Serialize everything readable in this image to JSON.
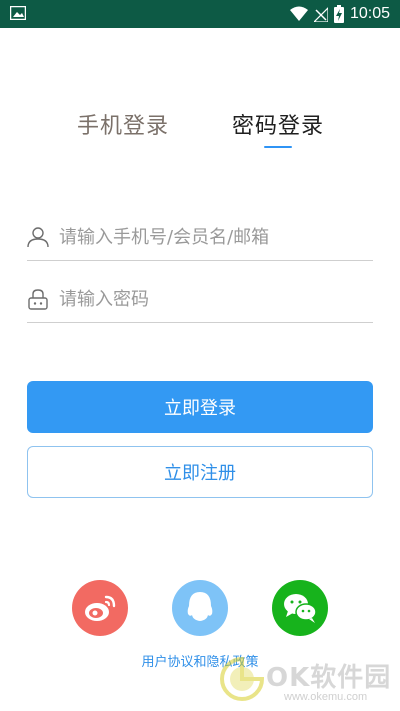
{
  "status_bar": {
    "time": "10:05",
    "icons": [
      "image-notification-icon",
      "wifi-icon",
      "signal-icon",
      "battery-charging-icon"
    ]
  },
  "tabs": [
    {
      "label": "手机登录",
      "active": false
    },
    {
      "label": "密码登录",
      "active": true
    }
  ],
  "form": {
    "username": {
      "placeholder": "请输入手机号/会员名/邮箱",
      "value": "",
      "icon": "person-icon"
    },
    "password": {
      "placeholder": "请输入密码",
      "value": "",
      "icon": "lock-icon"
    }
  },
  "buttons": {
    "login_label": "立即登录",
    "register_label": "立即注册"
  },
  "social_login": [
    {
      "name": "weibo",
      "icon": "weibo-icon",
      "color": "#f26a62"
    },
    {
      "name": "qq",
      "icon": "qq-icon",
      "color": "#7ec3f7"
    },
    {
      "name": "wechat",
      "icon": "wechat-icon",
      "color": "#17b31c"
    }
  ],
  "agreement_link": "用户协议和隐私政策",
  "watermark": {
    "title": "OK软件园",
    "url": "www.okemu.com"
  },
  "colors": {
    "status_bar": "#0d5a45",
    "accent": "#3399f3",
    "tab_inactive": "#7b716a"
  }
}
